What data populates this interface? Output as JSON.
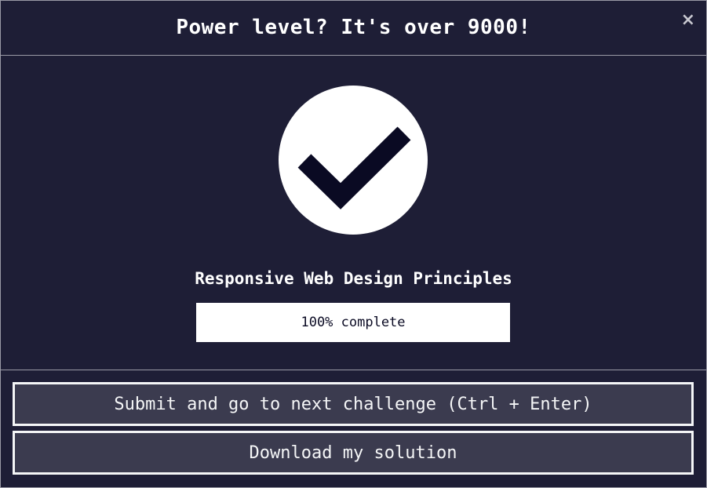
{
  "modal": {
    "title": "Power level? It's over 9000!",
    "close_label": "×"
  },
  "body": {
    "icon": "checkmark-circle-icon",
    "challenge_title": "Responsive Web Design Principles",
    "progress": {
      "percent": 100,
      "label": "100% complete"
    }
  },
  "footer": {
    "submit_label": "Submit and go to next challenge (Ctrl + Enter)",
    "download_label": "Download my solution"
  },
  "colors": {
    "background": "#1e1e36",
    "button_bg": "#3b3b4f",
    "checkmark": "#0a0a23"
  }
}
